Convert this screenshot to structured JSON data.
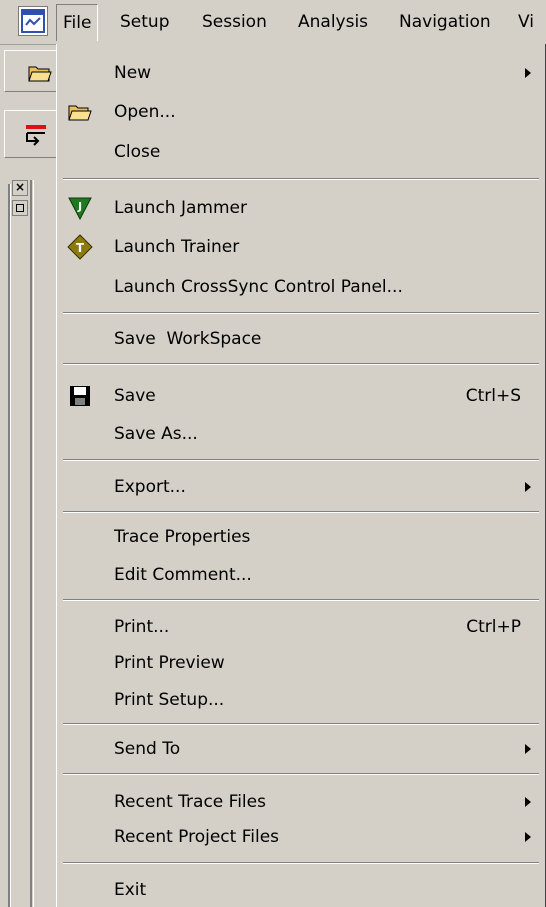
{
  "menubar": {
    "items": [
      "File",
      "Setup",
      "Session",
      "Analysis",
      "Navigation",
      "Vi"
    ]
  },
  "pane": {
    "close_glyph": "×"
  },
  "icons": {
    "app": "app-window-icon",
    "open": "open-folder-icon",
    "jammer": "jammer-icon",
    "trainer": "trainer-icon",
    "save": "floppy-disk-icon"
  },
  "colors": {
    "jammer_green": "#1f7a1f",
    "trainer_olive": "#8a7a10",
    "toolbar_red": "#e01010"
  },
  "file_menu": {
    "new": "New",
    "open": "Open...",
    "close": "Close",
    "launch_jammer": "Launch Jammer",
    "launch_trainer": "Launch Trainer",
    "launch_crosssync": "Launch CrossSync Control Panel...",
    "save_workspace": "Save  WorkSpace",
    "save": "Save",
    "save_shortcut": "Ctrl+S",
    "save_as": "Save As...",
    "export": "Export...",
    "trace_properties": "Trace Properties",
    "edit_comment": "Edit Comment...",
    "print": "Print...",
    "print_shortcut": "Ctrl+P",
    "print_preview": "Print Preview",
    "print_setup": "Print Setup...",
    "send_to": "Send To",
    "recent_trace": "Recent Trace Files",
    "recent_project": "Recent Project Files",
    "exit": "Exit"
  }
}
